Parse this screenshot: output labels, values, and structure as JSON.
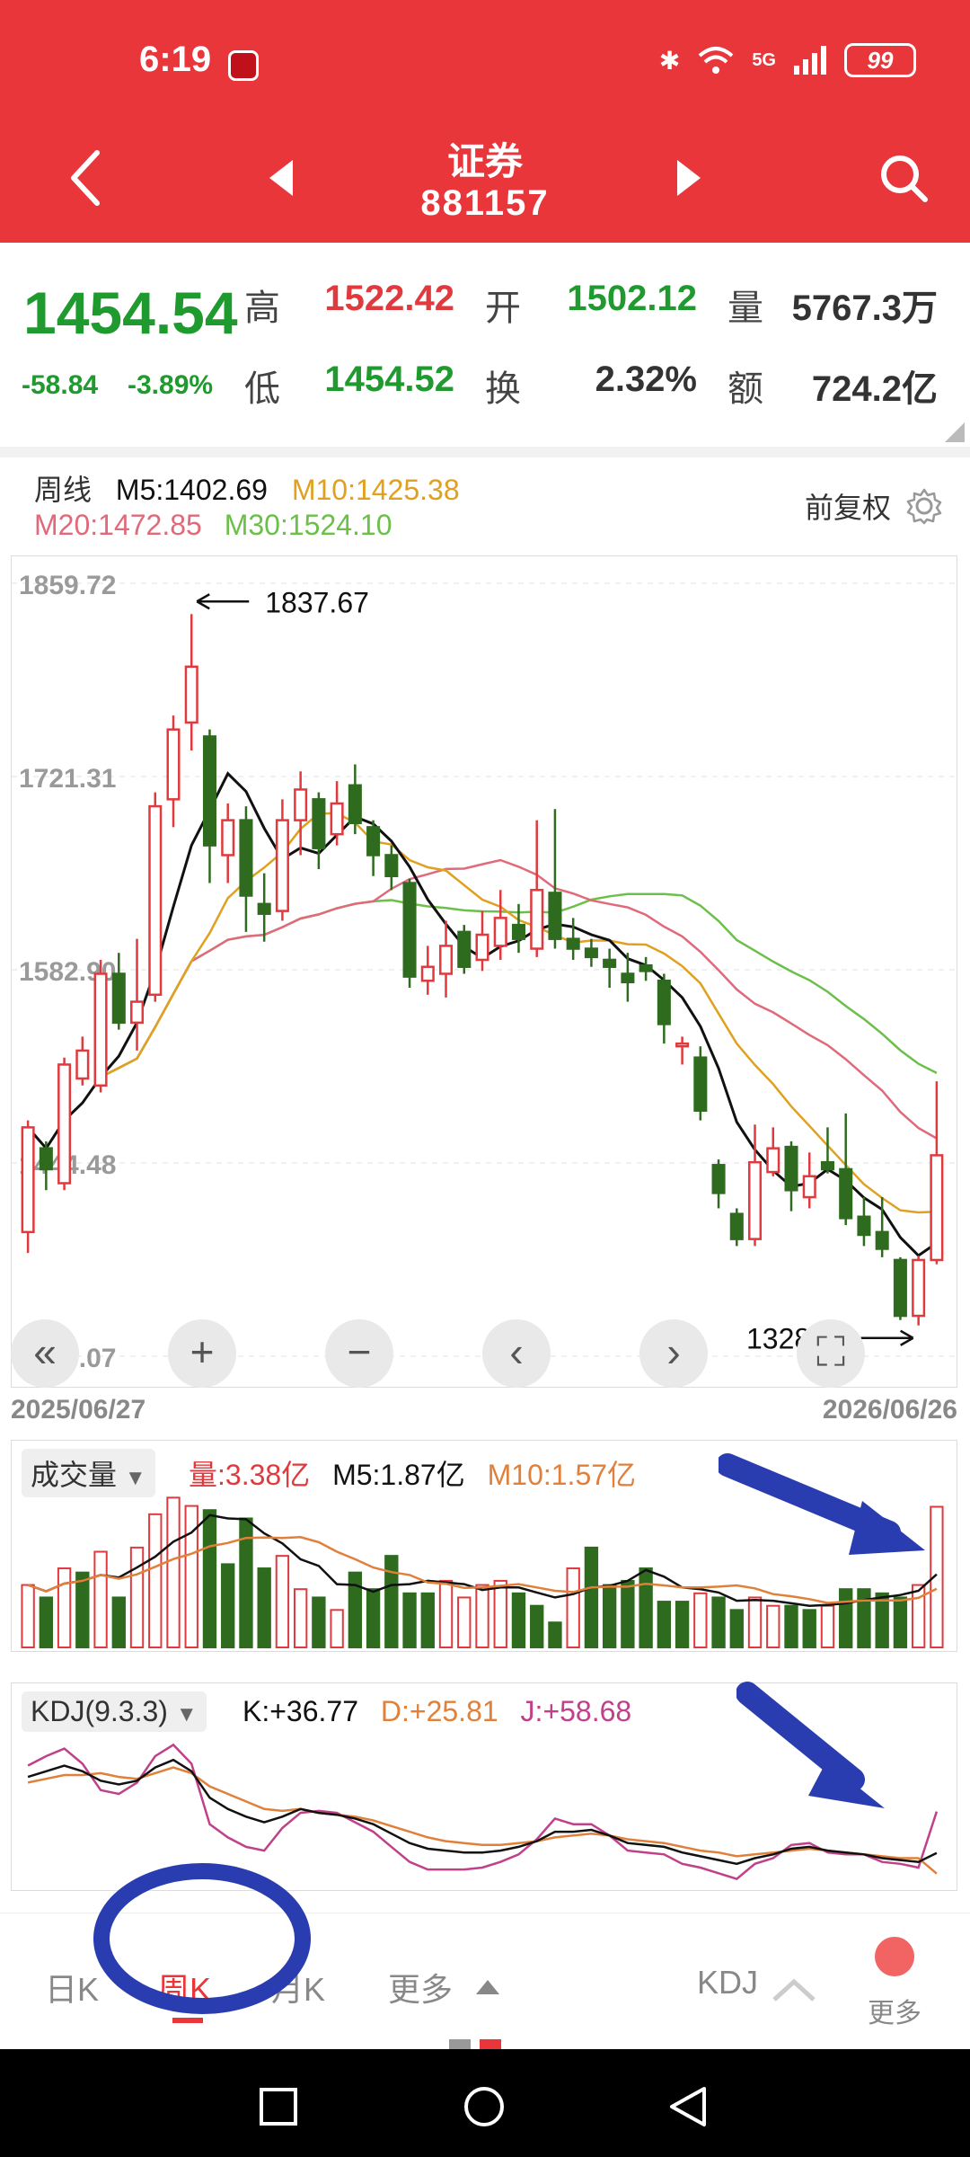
{
  "status": {
    "time": "6:19",
    "network": "5G",
    "battery": "99"
  },
  "header": {
    "name": "证券",
    "code": "881157"
  },
  "quote": {
    "price": "1454.54",
    "change": "-58.84",
    "change_pct": "-3.89%",
    "high_label": "高",
    "high": "1522.42",
    "open_label": "开",
    "open": "1502.12",
    "volume_label": "量",
    "volume": "5767.3万",
    "low_label": "低",
    "low": "1454.52",
    "turnover_label": "换",
    "turnover": "2.32%",
    "amount_label": "额",
    "amount": "724.2亿"
  },
  "colors": {
    "up": "#e03a3e",
    "down": "#2e6b1f",
    "accent": "#e8363b",
    "ma5": "#111111",
    "ma10": "#e0a020",
    "ma20": "#e06a7a",
    "ma30": "#6cc04a"
  },
  "ma": {
    "period": "周线",
    "m5": "M5:1402.69",
    "m10": "M10:1425.38",
    "m20": "M20:1472.85",
    "m30": "M30:1524.10",
    "adjust": "前复权"
  },
  "chart_data": [
    {
      "type": "candlestick",
      "title": "",
      "y_tick_labels": [
        "1859.72",
        "1721.31",
        "1582.90",
        "1444.48",
        "1306.07"
      ],
      "ylim": [
        1306.07,
        1859.72
      ],
      "high_annotation": "1837.67",
      "low_annotation": "1328.12",
      "x_start": "2025/06/27",
      "x_end": "2026/06/26",
      "candles": [
        {
          "o": 1395,
          "c": 1470,
          "h": 1475,
          "l": 1380
        },
        {
          "o": 1455,
          "c": 1440,
          "h": 1460,
          "l": 1425
        },
        {
          "o": 1430,
          "c": 1515,
          "h": 1520,
          "l": 1425
        },
        {
          "o": 1505,
          "c": 1525,
          "h": 1535,
          "l": 1500
        },
        {
          "o": 1500,
          "c": 1580,
          "h": 1590,
          "l": 1495
        },
        {
          "o": 1580,
          "c": 1545,
          "h": 1595,
          "l": 1540
        },
        {
          "o": 1545,
          "c": 1560,
          "h": 1605,
          "l": 1525
        },
        {
          "o": 1565,
          "c": 1700,
          "h": 1710,
          "l": 1560
        },
        {
          "o": 1705,
          "c": 1755,
          "h": 1765,
          "l": 1685
        },
        {
          "o": 1760,
          "c": 1800,
          "h": 1837.67,
          "l": 1740
        },
        {
          "o": 1750,
          "c": 1672,
          "h": 1755,
          "l": 1645
        },
        {
          "o": 1665,
          "c": 1690,
          "h": 1702,
          "l": 1645
        },
        {
          "o": 1690,
          "c": 1636,
          "h": 1700,
          "l": 1610
        },
        {
          "o": 1630,
          "c": 1623,
          "h": 1652,
          "l": 1603
        },
        {
          "o": 1625,
          "c": 1690,
          "h": 1705,
          "l": 1618
        },
        {
          "o": 1690,
          "c": 1712,
          "h": 1725,
          "l": 1665
        },
        {
          "o": 1705,
          "c": 1670,
          "h": 1710,
          "l": 1655
        },
        {
          "o": 1680,
          "c": 1702,
          "h": 1718,
          "l": 1672
        },
        {
          "o": 1715,
          "c": 1688,
          "h": 1730,
          "l": 1680
        },
        {
          "o": 1685,
          "c": 1665,
          "h": 1690,
          "l": 1650
        },
        {
          "o": 1665,
          "c": 1650,
          "h": 1672,
          "l": 1640
        },
        {
          "o": 1645,
          "c": 1578,
          "h": 1648,
          "l": 1570
        },
        {
          "o": 1575,
          "c": 1585,
          "h": 1600,
          "l": 1565
        },
        {
          "o": 1580,
          "c": 1600,
          "h": 1618,
          "l": 1563
        },
        {
          "o": 1610,
          "c": 1585,
          "h": 1615,
          "l": 1580
        },
        {
          "o": 1590,
          "c": 1608,
          "h": 1625,
          "l": 1582
        },
        {
          "o": 1600,
          "c": 1620,
          "h": 1640,
          "l": 1590
        },
        {
          "o": 1615,
          "c": 1605,
          "h": 1630,
          "l": 1595
        },
        {
          "o": 1598,
          "c": 1640,
          "h": 1690,
          "l": 1592
        },
        {
          "o": 1638,
          "c": 1605,
          "h": 1698,
          "l": 1598
        },
        {
          "o": 1605,
          "c": 1598,
          "h": 1620,
          "l": 1590
        },
        {
          "o": 1598,
          "c": 1592,
          "h": 1605,
          "l": 1585
        },
        {
          "o": 1590,
          "c": 1585,
          "h": 1598,
          "l": 1570
        },
        {
          "o": 1580,
          "c": 1574,
          "h": 1595,
          "l": 1560
        },
        {
          "o": 1586,
          "c": 1582,
          "h": 1592,
          "l": 1575
        },
        {
          "o": 1575,
          "c": 1544,
          "h": 1580,
          "l": 1530
        },
        {
          "o": 1530,
          "c": 1530,
          "h": 1535,
          "l": 1515
        },
        {
          "o": 1520,
          "c": 1482,
          "h": 1528,
          "l": 1475
        },
        {
          "o": 1443,
          "c": 1423,
          "h": 1447,
          "l": 1412
        },
        {
          "o": 1408,
          "c": 1390,
          "h": 1412,
          "l": 1385
        },
        {
          "o": 1390,
          "c": 1445,
          "h": 1472,
          "l": 1385
        },
        {
          "o": 1438,
          "c": 1455,
          "h": 1470,
          "l": 1435
        },
        {
          "o": 1456,
          "c": 1425,
          "h": 1460,
          "l": 1410
        },
        {
          "o": 1420,
          "c": 1435,
          "h": 1452,
          "l": 1412
        },
        {
          "o": 1445,
          "c": 1440,
          "h": 1470,
          "l": 1437
        },
        {
          "o": 1440,
          "c": 1405,
          "h": 1480,
          "l": 1400
        },
        {
          "o": 1406,
          "c": 1393,
          "h": 1420,
          "l": 1385
        },
        {
          "o": 1395,
          "c": 1383,
          "h": 1420,
          "l": 1377
        },
        {
          "o": 1375,
          "c": 1335,
          "h": 1377,
          "l": 1332
        },
        {
          "o": 1335,
          "c": 1375,
          "h": 1378,
          "l": 1328.12
        },
        {
          "o": 1375,
          "c": 1450,
          "h": 1503,
          "l": 1372
        }
      ]
    },
    {
      "type": "bar",
      "title": "",
      "name": "成交量",
      "y_unit": "亿",
      "volume": [
        1.5,
        1.2,
        1.9,
        1.8,
        2.3,
        1.2,
        2.4,
        3.2,
        3.6,
        3.4,
        3.3,
        2.0,
        3.1,
        1.9,
        2.2,
        1.4,
        1.2,
        0.9,
        1.8,
        1.4,
        2.2,
        1.3,
        1.3,
        1.6,
        1.2,
        1.5,
        1.6,
        1.3,
        1.0,
        0.6,
        1.9,
        2.4,
        1.5,
        1.6,
        1.9,
        1.1,
        1.1,
        1.3,
        1.2,
        0.9,
        1.2,
        1.0,
        1.0,
        0.9,
        1.0,
        1.4,
        1.4,
        1.3,
        1.2,
        1.5,
        3.38
      ],
      "volume_up": [
        true,
        false,
        true,
        false,
        true,
        false,
        true,
        true,
        true,
        true,
        false,
        false,
        false,
        false,
        true,
        true,
        false,
        true,
        false,
        false,
        false,
        false,
        false,
        true,
        true,
        true,
        true,
        false,
        false,
        false,
        true,
        false,
        false,
        false,
        false,
        false,
        false,
        true,
        false,
        false,
        true,
        true,
        false,
        false,
        true,
        false,
        false,
        false,
        false,
        true,
        true
      ]
    },
    {
      "type": "line",
      "title": "",
      "name": "KDJ",
      "k": [
        77,
        80,
        83,
        80,
        75,
        73,
        75,
        82,
        86,
        80,
        66,
        60,
        56,
        53,
        56,
        60,
        58,
        57,
        55,
        52,
        47,
        42,
        39,
        38,
        37,
        37,
        38,
        40,
        43,
        48,
        48,
        49,
        46,
        42,
        41,
        40,
        37,
        35,
        33,
        31,
        34,
        36,
        39,
        40,
        38,
        37,
        36,
        34,
        33,
        32,
        36.77
      ],
      "d": [
        74,
        76,
        78,
        78,
        79,
        77,
        76,
        79,
        82,
        79,
        72,
        68,
        64,
        60,
        59,
        60,
        58,
        57,
        56,
        54,
        51,
        48,
        45,
        43,
        42,
        41,
        41,
        42,
        43,
        45,
        46,
        47,
        46,
        44,
        43,
        42,
        40,
        38,
        37,
        35,
        36,
        37,
        38,
        39,
        38,
        37,
        36,
        35,
        34,
        34,
        25.81
      ],
      "j": [
        83,
        88,
        92,
        84,
        70,
        68,
        74,
        88,
        94,
        84,
        52,
        45,
        40,
        38,
        50,
        58,
        59,
        58,
        53,
        48,
        40,
        32,
        28,
        28,
        28,
        29,
        32,
        36,
        44,
        55,
        52,
        52,
        46,
        38,
        37,
        36,
        31,
        29,
        26,
        23,
        31,
        34,
        41,
        42,
        37,
        36,
        36,
        32,
        31,
        29,
        58.68
      ]
    }
  ],
  "volume_panel": {
    "selector": "成交量",
    "vol": "量:3.38亿",
    "m5": "M5:1.87亿",
    "m10": "M10:1.57亿"
  },
  "kdj_panel": {
    "selector": "KDJ(9.3.3)",
    "k": "K:+36.77",
    "d": "D:+25.81",
    "j": "J:+58.68"
  },
  "tabs": {
    "day": "日K",
    "week": "周K",
    "month": "月K",
    "more": "更多",
    "kdj": "KDJ",
    "more2": "更多"
  }
}
